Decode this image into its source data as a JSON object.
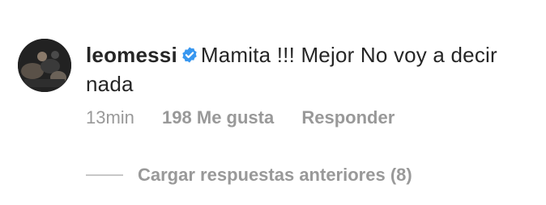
{
  "comment": {
    "username": "leomessi",
    "text": "Mamita !!! Mejor No voy a decir nada",
    "time": "13min",
    "likes": "198 Me gusta",
    "reply": "Responder"
  },
  "replies": {
    "load_label": "Cargar respuestas anteriores (8)"
  },
  "colors": {
    "verified_badge": "#3897f0",
    "meta_text": "#999999",
    "primary_text": "#262626"
  }
}
